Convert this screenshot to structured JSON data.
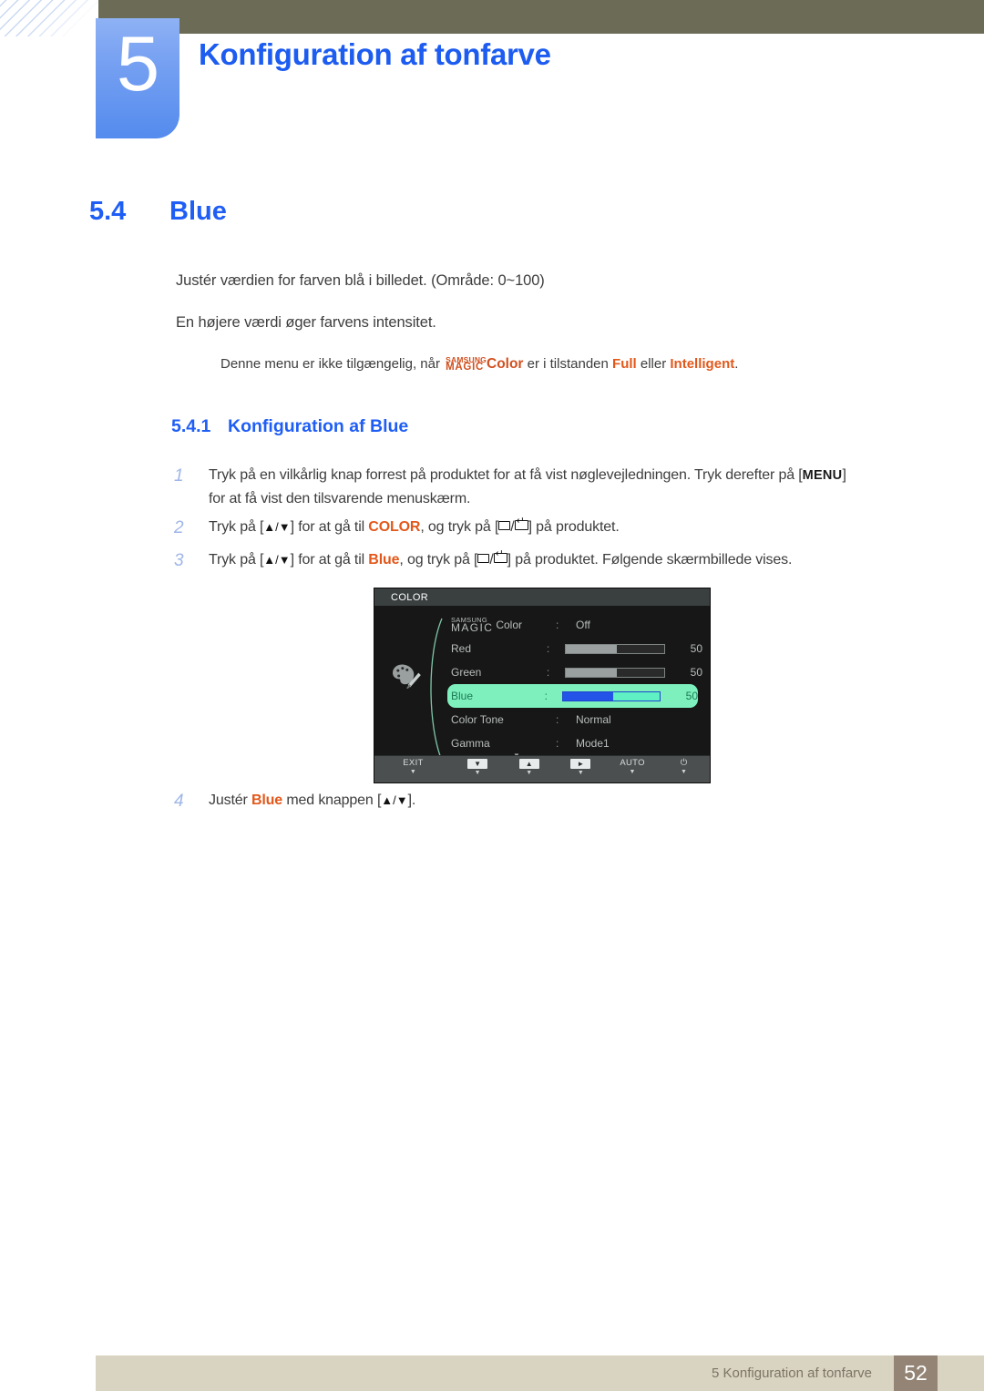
{
  "chapter": {
    "number": "5",
    "title": "Konfiguration af tonfarve"
  },
  "section": {
    "number": "5.4",
    "title": "Blue"
  },
  "intro": {
    "line1": "Justér værdien for farven blå i billedet. (Område: 0~100)",
    "line2": "En højere værdi øger farvens intensitet.",
    "note_prefix": "Denne menu er ikke tilgængelig, når ",
    "note_magic_top": "SAMSUNG",
    "note_magic_bottom": "MAGIC",
    "note_magic_suffix": "Color",
    "note_middle": " er i tilstanden ",
    "note_mode1": "Full",
    "note_conj": " eller ",
    "note_mode2": "Intelligent",
    "note_end": "."
  },
  "subsection": {
    "number": "5.4.1",
    "title": "Konfiguration af Blue"
  },
  "steps": [
    {
      "number": "1",
      "part1": "Tryk på en vilkårlig knap forrest på produktet for at få vist nøglevejledningen. Tryk derefter på [",
      "key": "MENU",
      "part2": "]",
      "line2": "for at få vist den tilsvarende menuskærm."
    },
    {
      "number": "2",
      "part1": "Tryk på [",
      "arrows": "▲/▼",
      "part2": "] for at gå til ",
      "target": "COLOR",
      "part3": ", og tryk på [",
      "part4": "] på produktet."
    },
    {
      "number": "3",
      "part1": "Tryk på [",
      "arrows": "▲/▼",
      "part2": "] for at gå til ",
      "target": "Blue",
      "part3": ", og tryk på [",
      "part4": "] på produktet. Følgende skærmbillede vises."
    },
    {
      "number": "4",
      "part1": "Justér ",
      "target": "Blue",
      "part2": " med knappen [",
      "arrows": "▲/▼",
      "part3": "]."
    }
  ],
  "osd": {
    "title": "COLOR",
    "palette_icon": "palette-icon",
    "rows": [
      {
        "label_top": "SAMSUNG",
        "label_bottom": "MAGIC",
        "label_suffix": "Color",
        "colon": ":",
        "value": "Off",
        "type": "text",
        "highlight": false
      },
      {
        "label": "Red",
        "colon": ":",
        "value": "50",
        "type": "slider",
        "fill": 52,
        "highlight": false
      },
      {
        "label": "Green",
        "colon": ":",
        "value": "50",
        "type": "slider",
        "fill": 52,
        "highlight": false
      },
      {
        "label": "Blue",
        "colon": ":",
        "value": "50",
        "type": "slider",
        "fill": 52,
        "highlight": true
      },
      {
        "label": "Color Tone",
        "colon": ":",
        "value": "Normal",
        "type": "text",
        "highlight": false
      },
      {
        "label": "Gamma",
        "colon": ":",
        "value": "Mode1",
        "type": "text",
        "highlight": false
      }
    ],
    "scroll_indicator": "▼",
    "buttons": [
      {
        "label": "EXIT",
        "sub": "▼",
        "icon": false
      },
      {
        "label": "▼",
        "sub": "▼",
        "icon": true
      },
      {
        "label": "▲",
        "sub": "▼",
        "icon": true
      },
      {
        "label": "►",
        "sub": "▼",
        "icon": true
      },
      {
        "label": "AUTO",
        "sub": "▼",
        "icon": false
      },
      {
        "label": "⏻",
        "sub": "▼",
        "icon": false
      }
    ]
  },
  "footer": {
    "text": "5 Konfiguration af tonfarve",
    "page": "52"
  },
  "colors": {
    "accent_blue": "#1f5ef5",
    "tab_blue": "#548bee",
    "header_olive": "#6c6b56",
    "orange": "#e2581b",
    "magic_orange": "#d1501f",
    "osd_highlight": "#7ef0bd",
    "osd_blue_fill": "#2453e8",
    "footer_beige": "#d9d3c1",
    "footer_page_box": "#938475"
  }
}
